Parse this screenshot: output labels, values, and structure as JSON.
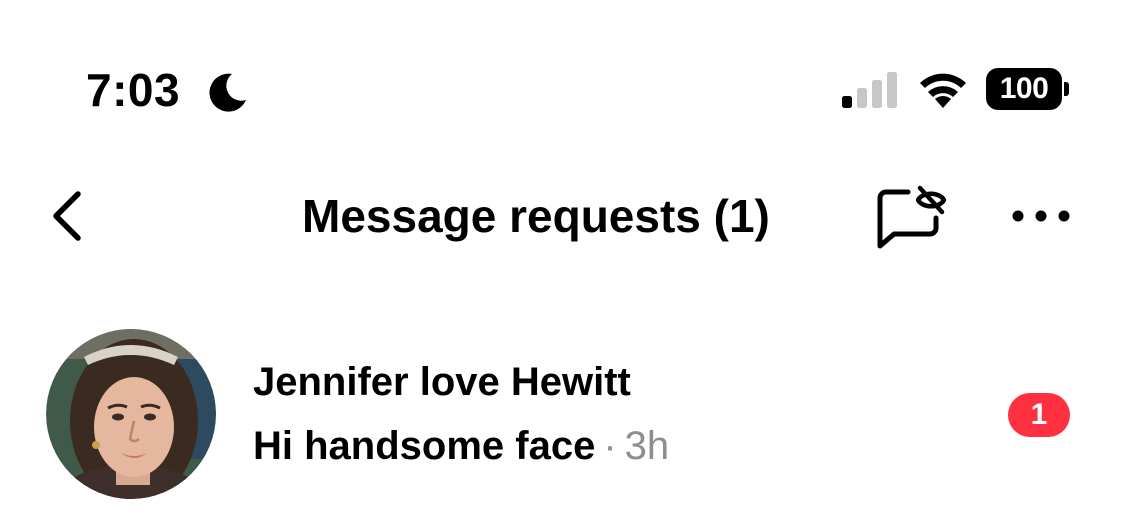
{
  "status_bar": {
    "time": "7:03",
    "focus_mode_icon": "moon-icon",
    "signal_icon": "cellular-signal-icon",
    "signal_bars_active": 1,
    "signal_bars_total": 4,
    "wifi_icon": "wifi-icon",
    "battery_level": "100"
  },
  "header": {
    "back_icon": "chevron-left-icon",
    "title": "Message requests (1)",
    "hidden_requests_icon": "message-hidden-icon",
    "more_icon": "more-horizontal-icon"
  },
  "requests": [
    {
      "name": "Jennifer love Hewitt",
      "preview": "Hi handsome face",
      "separator": "·",
      "time": "3h",
      "unread_count": "1",
      "avatar_icon": "profile-photo"
    }
  ],
  "colors": {
    "badge": "#ff3040",
    "secondary_text": "#8e8e8e",
    "primary_text": "#000000",
    "background": "#ffffff"
  }
}
